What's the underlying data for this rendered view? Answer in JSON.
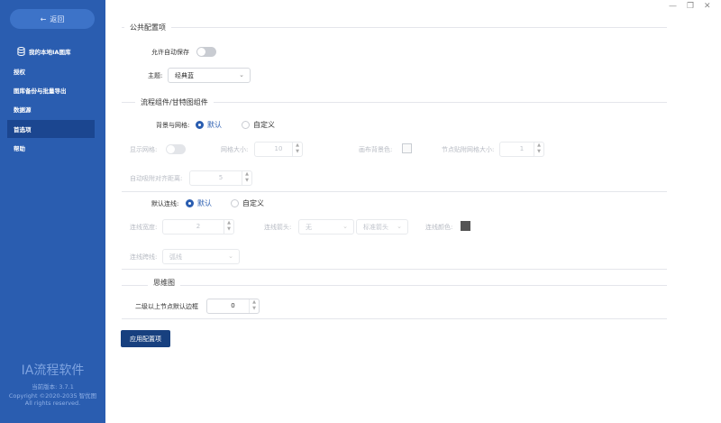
{
  "sidebar": {
    "back_label": "返回",
    "items": [
      {
        "label": "我的本地IA图库"
      },
      {
        "label": "授权"
      },
      {
        "label": "图库备份与批量导出"
      },
      {
        "label": "数据源"
      },
      {
        "label": "首选项"
      },
      {
        "label": "帮助"
      }
    ],
    "brand": "IA流程软件",
    "version": "当前版本: 3.7.1",
    "copyright": "Copyright ©2020-2035 智优图",
    "rights": "All rights reserved."
  },
  "sections": {
    "public": "公共配置项",
    "flow": "流程组件/甘特图组件",
    "mind": "思维图"
  },
  "public": {
    "autosave_label": "允许自动保存",
    "theme_label": "主题:",
    "theme_value": "经典蓝"
  },
  "flow": {
    "bg_grid_label": "背景与网格:",
    "radio_default": "默认",
    "radio_custom": "自定义",
    "show_grid_label": "显示网格:",
    "grid_size_label": "网格大小:",
    "grid_size_value": "10",
    "canvas_bg_label": "画布背景色:",
    "snap_grid_label": "节点贴附网格大小:",
    "snap_grid_value": "1",
    "auto_align_label": "自动吸附对齐距离:",
    "auto_align_value": "5",
    "default_line_label": "默认连线:",
    "line_default": "默认",
    "line_custom": "自定义",
    "line_width_label": "连线宽度:",
    "line_width_value": "2",
    "line_arrow_label": "连线箭头:",
    "line_arrow_start": "无",
    "line_arrow_end": "标准箭头",
    "line_color_label": "连线颜色:",
    "line_jump_label": "连线跨线:",
    "line_jump_value": "弧线"
  },
  "mind": {
    "border_label": "二级以上节点默认边框",
    "border_value": "0"
  },
  "apply_label": "应用配置项",
  "colors": {
    "sidebar": "#2a5db0",
    "active": "#1b4690",
    "primary_btn": "#17407f",
    "line_color_swatch": "#555555"
  }
}
